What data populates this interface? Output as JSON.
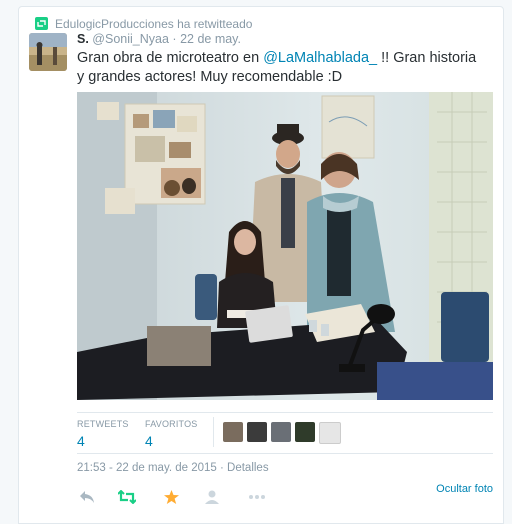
{
  "retweet_line": {
    "text": "EdulogicProducciones ha retwitteado"
  },
  "author": {
    "name": "S.",
    "handle": "@Sonii_Nyaa",
    "separator": "·",
    "date": "22 de may."
  },
  "tweet": {
    "text_before": "Gran obra de microteatro en ",
    "mention": "@LaMalhablada_",
    "text_after": " !! Gran historia y grandes actores! Muy recomendable :D"
  },
  "stats": {
    "retweets_label": "RETWEETS",
    "retweets_count": "4",
    "favorites_label": "FAVORITOS",
    "favorites_count": "4"
  },
  "timestamp": "21:53 - 22 de may. de 2015 · Detalles",
  "actions": {
    "hide_photo": "Ocultar foto"
  },
  "icons": {
    "retweet_badge": "retweet-icon",
    "reply": "reply-icon",
    "retweet": "retweet-icon",
    "favorite": "star-icon",
    "follow": "follow-icon",
    "more": "more-icon"
  },
  "colors": {
    "link": "#0084b4",
    "muted": "#8899a6",
    "retweet_green": "#19cf86",
    "favorite_gold": "#ffac33"
  }
}
